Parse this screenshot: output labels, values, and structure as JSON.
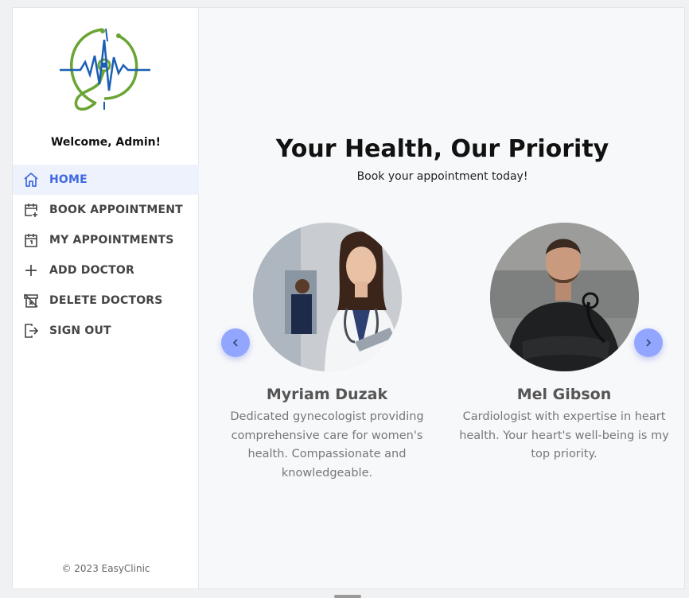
{
  "app": {
    "name": "EasyClinic"
  },
  "sidebar": {
    "welcome": "Welcome, Admin!",
    "items": [
      {
        "label": "HOME",
        "icon": "home-icon",
        "active": true
      },
      {
        "label": "BOOK APPOINTMENT",
        "icon": "calendar-plus-icon",
        "active": false
      },
      {
        "label": "MY APPOINTMENTS",
        "icon": "calendar-day-icon",
        "active": false
      },
      {
        "label": "ADD DOCTOR",
        "icon": "plus-icon",
        "active": false
      },
      {
        "label": "DELETE DOCTORS",
        "icon": "archive-x-icon",
        "active": false
      },
      {
        "label": "SIGN OUT",
        "icon": "sign-out-icon",
        "active": false
      }
    ],
    "footer": "© 2023 EasyClinic"
  },
  "hero": {
    "title": "Your Health, Our Priority",
    "subtitle": "Book your appointment today!"
  },
  "doctors": [
    {
      "name": "Myriam Duzak",
      "description": "Dedicated gynecologist providing comprehensive care for women's health. Compassionate and knowledgeable."
    },
    {
      "name": "Mel Gibson",
      "description": "Cardiologist with expertise in heart health. Your heart's well-being is my top priority."
    }
  ],
  "carousel": {
    "prev_icon": "chevron-left-icon",
    "next_icon": "chevron-right-icon"
  },
  "colors": {
    "accent": "#4169e1",
    "active_bg": "#eef2fc",
    "arrow_bg": "#93a6ff",
    "logo_green": "#6aa434",
    "logo_blue": "#1a5fb4"
  }
}
